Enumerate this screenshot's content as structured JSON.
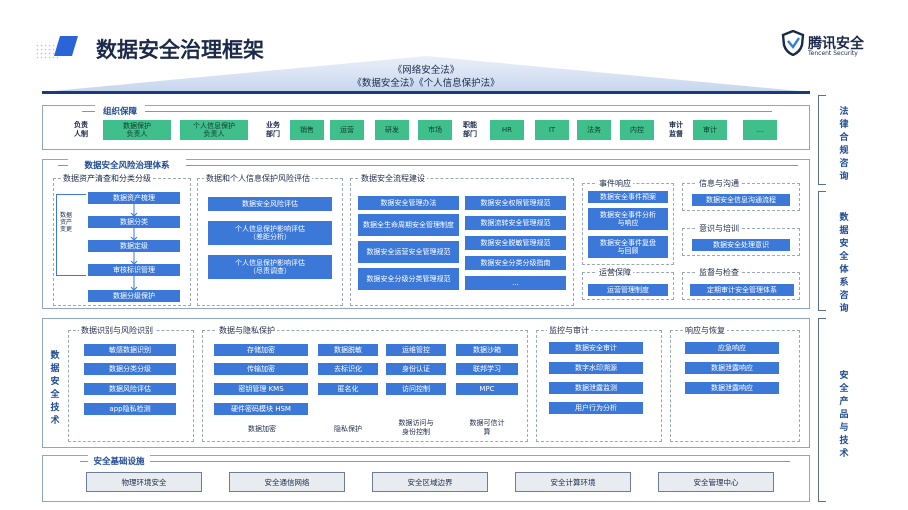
{
  "title": "数据安全治理框架",
  "logo": {
    "name": "腾讯安全",
    "sub": "Tencent Security"
  },
  "laws": {
    "line1": "《网络安全法》",
    "line2": "《数据安全法》《个人信息保护法》"
  },
  "org": {
    "title": "组织保障",
    "responsible_label": "负责\n人制",
    "responsible": [
      "数据保护\n负责人",
      "个人信息保护\n负责人"
    ],
    "business_label": "业务\n部门",
    "business": [
      "销售",
      "运营",
      "研发",
      "市场"
    ],
    "function_label": "职能\n部门",
    "function": [
      "HR",
      "IT",
      "法务",
      "内控"
    ],
    "audit_label": "审计\n监督",
    "audit": [
      "审计",
      "..."
    ]
  },
  "risk": {
    "title": "数据安全风险治理体系",
    "asset": {
      "title": "数据资产清查和分类分级",
      "side": "数据资产变更",
      "items": [
        "数据资产梳理",
        "数据分类",
        "数据定级",
        "审核标识管理",
        "数据分级保护"
      ]
    },
    "assess": {
      "title": "数据和个人信息保护风险评估",
      "items": [
        "数据安全风险评估",
        "个人信息保护影响评估\n（差距分析）",
        "个人信息保护影响评估\n（尽责调查）"
      ]
    },
    "process": {
      "title": "数据安全流程建设",
      "left": [
        "数据安全管理办法",
        "数据全生命周期安全管理制度",
        "数据安全运营安全管理规范",
        "数据安全分级分类管理规范"
      ],
      "right": [
        "数据安全权限管理规范",
        "数据流转安全管理规范",
        "数据安全脱敏管理规范",
        "数据安全分类分级指南",
        "..."
      ]
    },
    "incident": {
      "title": "事件响应",
      "items": [
        "数据安全事件预案",
        "数据安全事件分析\n与响应",
        "数据安全事件复盘\n与回顾"
      ]
    },
    "ops": {
      "title": "运营保障",
      "items": [
        "运营管理制度"
      ]
    },
    "info": {
      "title": "信息与沟通",
      "items": [
        "数据安全信息沟通流程"
      ]
    },
    "training": {
      "title": "意识与培训",
      "items": [
        "数据安全处理意识"
      ]
    },
    "supervision": {
      "title": "监督与检查",
      "items": [
        "定期审计安全管理体系"
      ]
    }
  },
  "tech": {
    "side": "数据安全技术",
    "identify": {
      "title": "数据识别与风险识别",
      "items": [
        "敏感数据识别",
        "数据分类分级",
        "数据风险评估",
        "app隐私检测"
      ]
    },
    "privacy": {
      "title": "数据与隐私保护",
      "col1": [
        "存储加密",
        "传输加密",
        "密钥管理 KMS",
        "硬件密码模块 HSM"
      ],
      "col2": [
        "数据脱敏",
        "去标识化",
        "匿名化"
      ],
      "col3": [
        "运维管控",
        "身份认证",
        "访问控制"
      ],
      "col4": [
        "数据沙箱",
        "联邦学习",
        "MPC"
      ],
      "captions": [
        "数据加密",
        "隐私保护",
        "数据访问与\n身份控制",
        "数据可信计\n算"
      ]
    },
    "monitor": {
      "title": "监控与审计",
      "items": [
        "数据安全审计",
        "数字水印溯源",
        "数据泄露监测",
        "用户行为分析"
      ]
    },
    "response": {
      "title": "响应与恢复",
      "items": [
        "应急响应",
        "数据泄露响应",
        "数据泄露响应"
      ]
    }
  },
  "infra": {
    "title": "安全基础设施",
    "items": [
      "物理环境安全",
      "安全通信网络",
      "安全区域边界",
      "安全计算环境",
      "安全管理中心"
    ]
  },
  "right_labels": [
    "法律合规咨询",
    "数据安全体系咨询",
    "安全产品与技术"
  ],
  "colors": {
    "green": "#3fbf8b",
    "blue": "#3c78d8",
    "navy": "#1b2a4a",
    "accent": "#1f4a93"
  }
}
